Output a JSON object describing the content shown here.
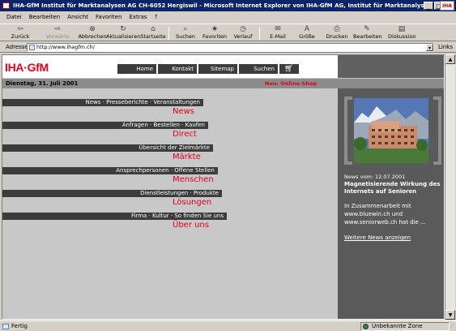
{
  "window": {
    "title": "IHA-GfM Institut für Marktanalysen AG CH-6052 Hergiswil - Microsoft Internet Explorer von IHA-GfM AG, Institut für Marktanalyse",
    "logo_text": "IHA"
  },
  "menu": [
    "Datei",
    "Bearbeiten",
    "Ansicht",
    "Favoriten",
    "Extras",
    "?"
  ],
  "toolbar": [
    {
      "label": "Zurück",
      "icon": "back-arrow-icon",
      "glyph": "⇦",
      "disabled": false
    },
    {
      "label": "Vorwärts",
      "icon": "forward-arrow-icon",
      "glyph": "⇨",
      "disabled": true
    },
    {
      "label": "Abbrechen",
      "icon": "stop-icon",
      "glyph": "⊗",
      "disabled": false
    },
    {
      "label": "Aktualisieren",
      "icon": "refresh-icon",
      "glyph": "↻",
      "disabled": false
    },
    {
      "label": "Startseite",
      "icon": "home-icon",
      "glyph": "⌂",
      "disabled": false
    },
    {
      "label": "Suchen",
      "icon": "search-icon",
      "glyph": "⌕",
      "disabled": false
    },
    {
      "label": "Favoriten",
      "icon": "favorites-icon",
      "glyph": "★",
      "disabled": false
    },
    {
      "label": "Verlauf",
      "icon": "history-icon",
      "glyph": "◷",
      "disabled": false
    },
    {
      "label": "E-Mail",
      "icon": "mail-icon",
      "glyph": "✉",
      "disabled": false
    },
    {
      "label": "Größe",
      "icon": "font-size-icon",
      "glyph": "A",
      "disabled": false
    },
    {
      "label": "Drucken",
      "icon": "print-icon",
      "glyph": "⎙",
      "disabled": false
    },
    {
      "label": "Bearbeiten",
      "icon": "edit-icon",
      "glyph": "✎",
      "disabled": false
    },
    {
      "label": "Diskussion",
      "icon": "discuss-icon",
      "glyph": "▤",
      "disabled": false
    }
  ],
  "address": {
    "label": "Adresse",
    "url": "http://www.ihagfm.ch/",
    "links_label": "Links"
  },
  "page": {
    "logo": "IHA·GfM",
    "nav": [
      "Home",
      "Kontakt",
      "Sitemap",
      "Suchen"
    ],
    "date": "Dienstag, 31. Juli 2001",
    "shop_link": "Neu: Online-Shop",
    "sections": [
      {
        "bar": "News · Presseberichte · Veranstaltungen",
        "title": "News"
      },
      {
        "bar": "Anfragen · Bestellen · Kaufen",
        "title": "Direct"
      },
      {
        "bar": "Übersicht der Zielmärkte",
        "title": "Märkte"
      },
      {
        "bar": "Ansprechpersonen · Offene Stellen",
        "title": "Menschen"
      },
      {
        "bar": "Dienstleistungen · Produkte",
        "title": "Lösungen"
      },
      {
        "bar": "Firma · Kultur · So finden Sie uns",
        "title": "Über uns"
      }
    ],
    "news": {
      "date": "News vom: 12.07.2001",
      "title": "Magnetisierende Wirkung des Internets auf Senioren",
      "text": "In Zusammenarbeit mit www.bluewin.ch und www.seniorweb.ch hat die ...",
      "more": "Weitere News anzeigen"
    }
  },
  "status": {
    "text": "Fertig",
    "zone": "Unbekannte Zone (Gemischt)"
  }
}
